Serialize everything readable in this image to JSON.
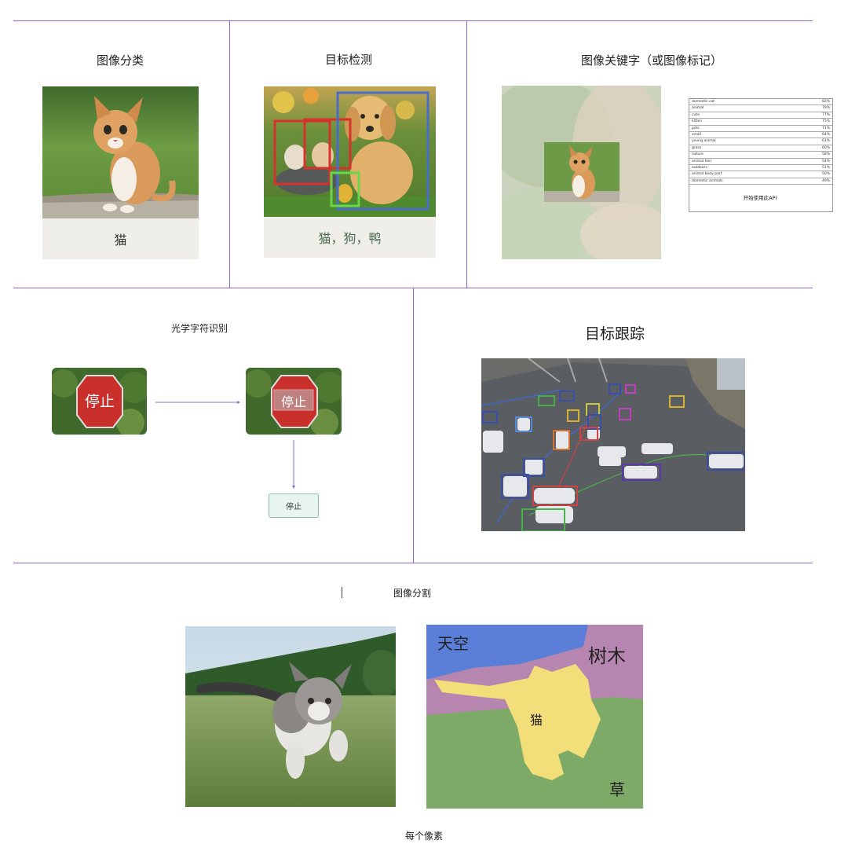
{
  "panels": {
    "classification": {
      "title": "图像分类",
      "caption": "猫"
    },
    "detection": {
      "title": "目标检测",
      "caption": "猫，狗，鸭"
    },
    "keywords": {
      "title": "图像关键字（或图像标记）",
      "rows": [
        {
          "label": "domestic cat",
          "score": "82%"
        },
        {
          "label": "animal",
          "score": "79%"
        },
        {
          "label": "cute",
          "score": "77%"
        },
        {
          "label": "kitten",
          "score": "75%"
        },
        {
          "label": "pets",
          "score": "71%"
        },
        {
          "label": "small",
          "score": "64%"
        },
        {
          "label": "young animal",
          "score": "61%"
        },
        {
          "label": "grass",
          "score": "60%"
        },
        {
          "label": "nature",
          "score": "58%"
        },
        {
          "label": "animal hair",
          "score": "54%"
        },
        {
          "label": "outdoors",
          "score": "51%"
        },
        {
          "label": "animal body part",
          "score": "50%"
        },
        {
          "label": "domestic animals",
          "score": "49%"
        }
      ],
      "button": "开始使用此API"
    },
    "ocr": {
      "title": "光学字符识别",
      "sign_text": "停止",
      "output": "停止"
    },
    "tracking": {
      "title": "目标跟踪"
    },
    "segmentation": {
      "title": "图像分割",
      "labels": {
        "sky": "天空",
        "trees": "树木",
        "cat": "猫",
        "grass": "草"
      },
      "caption": "每个像素"
    }
  },
  "colors": {
    "divider": "#8a6cc8",
    "seg_sky": "#5b7fd9",
    "seg_trees": "#b786b0",
    "seg_cat": "#f2df7a",
    "seg_grass": "#7dab67"
  }
}
